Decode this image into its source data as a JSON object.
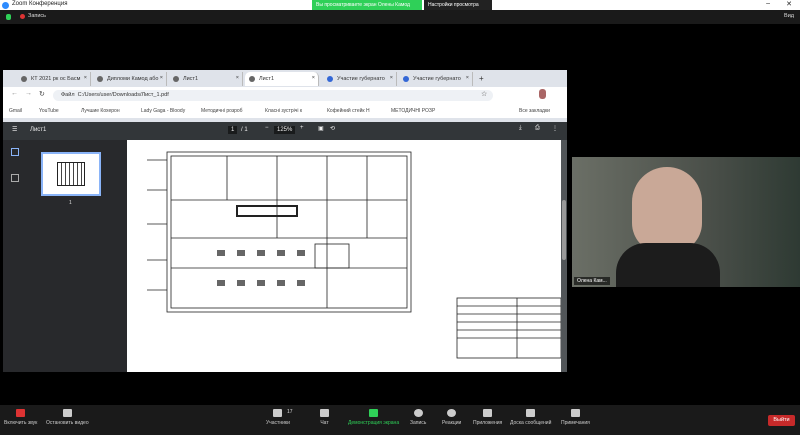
{
  "window": {
    "title": "Zoom Конференция",
    "share_banner": "Вы просматриваете экран Олены Камод",
    "view_options": "Настройки просмотра",
    "recording": "Запись",
    "view": "Вид"
  },
  "browser": {
    "tabs": [
      {
        "label": "КТ 2021 рк ос Басм"
      },
      {
        "label": "Дипломи Камод або"
      },
      {
        "label": "Лист1"
      },
      {
        "label": "Лист1"
      },
      {
        "label": "Участие губернато"
      },
      {
        "label": "Участие губернато"
      }
    ],
    "active_tab": 3,
    "address": {
      "site": "Файл",
      "url": "C:/Users/user/Downloads/Лист_1.pdf"
    },
    "bookmarks": [
      "Gmail",
      "YouTube",
      "Лучшие Кохерон",
      "Lady Gaga - Bloody",
      "Методичні розроб",
      "Класні зустрічі к",
      "Кофейний стейк Н",
      "МЕТОДИЧНІ РОЗР"
    ],
    "all_bookmarks": "Все закладки"
  },
  "pdf": {
    "title": "Лист1",
    "page_current": "1",
    "page_total": "/ 1",
    "zoom": "125%",
    "thumb_label": "1"
  },
  "participant": {
    "name": "Олена Кам..."
  },
  "toolbar": {
    "mute": "Включить звук",
    "video": "Остановить видео",
    "participants": "Участники",
    "participants_count": "17",
    "chat": "Чат",
    "share": "Демонстрация экрана",
    "record": "Запись",
    "reactions": "Реакции",
    "apps": "Приложения",
    "whiteboard": "Доска сообщений",
    "notes": "Примечания",
    "leave": "Выйти"
  },
  "colors": {
    "share_green": "#2fd058",
    "leave_red": "#c72a2a",
    "pdf_toolbar": "#323639"
  }
}
